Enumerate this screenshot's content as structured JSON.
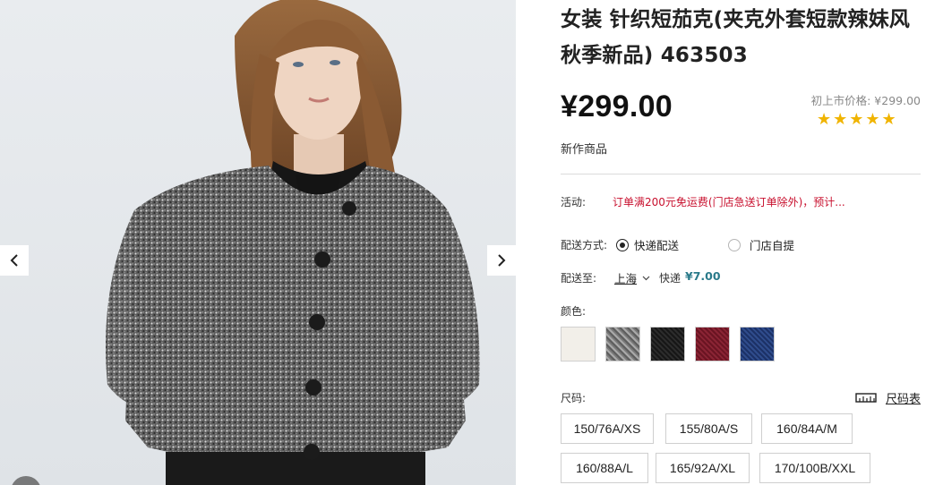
{
  "gallery": {
    "prev_icon": "chevron-left-icon",
    "next_icon": "chevron-right-icon"
  },
  "product": {
    "title": "女装 针织短茄克(夹克外套短款辣妹风秋季新品) 463503",
    "price": "¥299.00",
    "original_price": "初上市价格: ¥299.00",
    "rating_stars": "★★★★★",
    "rating": 5,
    "new_tag": "新作商品"
  },
  "promo": {
    "label": "活动:",
    "text": "订单满200元免运费(门店急送订单除外)，预计..."
  },
  "delivery": {
    "method_label": "配送方式:",
    "options": [
      {
        "label": "快递配送",
        "selected": true
      },
      {
        "label": "门店自提",
        "selected": false
      }
    ],
    "to_label": "配送至:",
    "location": "上海",
    "shipping_method": "快递",
    "shipping_fee": "¥7.00"
  },
  "color": {
    "label": "颜色:",
    "swatches": [
      {
        "name": "white",
        "hex": "#f2efe9"
      },
      {
        "name": "gray",
        "hex": "#7c7c7c"
      },
      {
        "name": "black",
        "hex": "#1c1c1c"
      },
      {
        "name": "wine",
        "hex": "#7a1c2a"
      },
      {
        "name": "navy",
        "hex": "#263f7a"
      }
    ]
  },
  "size": {
    "label": "尺码:",
    "chart_link": "尺码表",
    "chart_icon": "ruler-icon",
    "options": [
      "150/76A/XS",
      "155/80A/S",
      "160/84A/M",
      "160/88A/L",
      "165/92A/XL",
      "170/100B/XXL"
    ]
  },
  "colors": {
    "price": "#111111",
    "promo": "#c8102e",
    "fee": "#2a7a8a",
    "stars": "#f0b400"
  }
}
